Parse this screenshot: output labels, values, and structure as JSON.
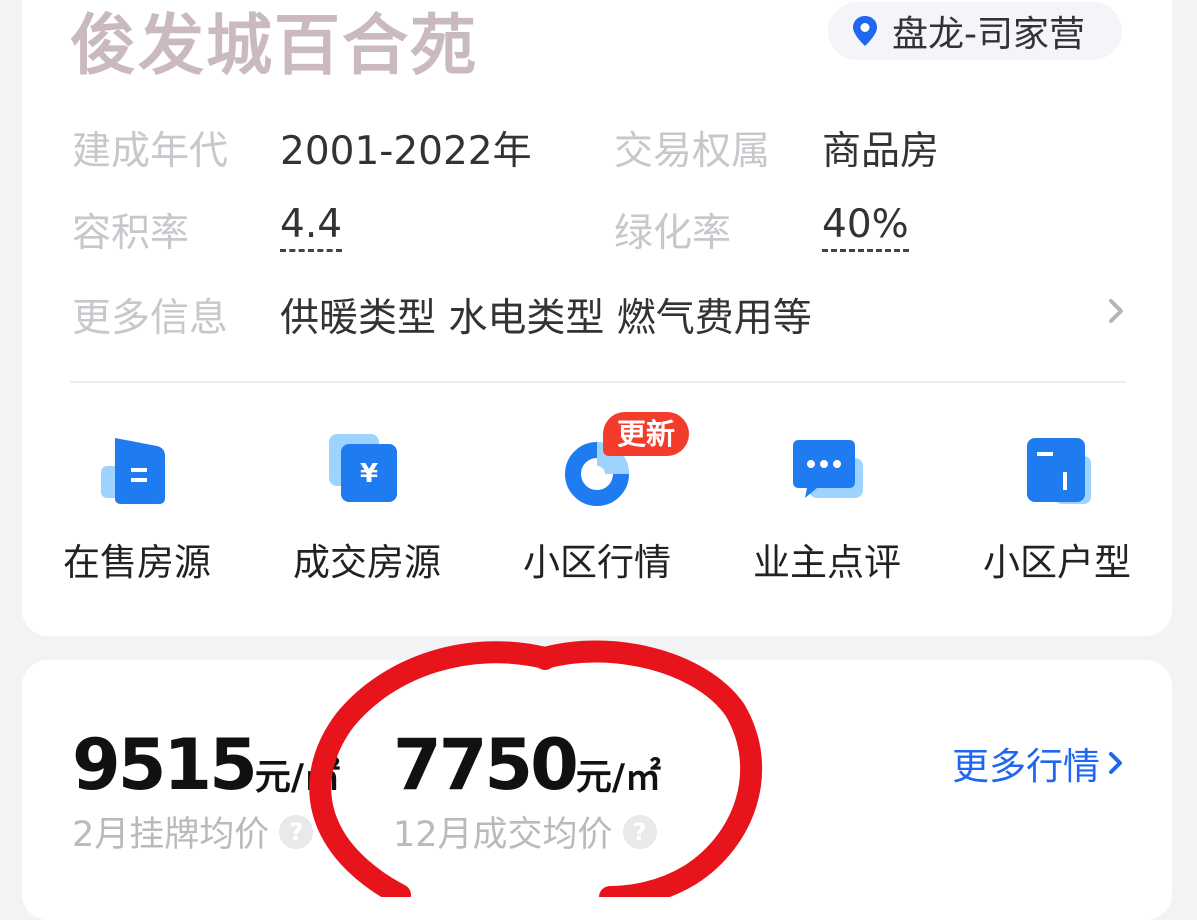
{
  "header": {
    "title": "俊发城百合苑",
    "location": "盘龙-司家营"
  },
  "info": {
    "build_year_label": "建成年代",
    "build_year_value": "2001-2022年",
    "ownership_label": "交易权属",
    "ownership_value": "商品房",
    "plot_ratio_label": "容积率",
    "plot_ratio_value": "4.4",
    "green_ratio_label": "绿化率",
    "green_ratio_value": "40%",
    "more_label": "更多信息",
    "more_value": "供暖类型 水电类型 燃气费用等"
  },
  "quick_links": [
    {
      "label": "在售房源",
      "icon": "listing-doc-icon"
    },
    {
      "label": "成交房源",
      "icon": "yuan-doc-icon"
    },
    {
      "label": "小区行情",
      "icon": "donut-chart-icon",
      "badge": "更新"
    },
    {
      "label": "业主点评",
      "icon": "chat-bubble-icon"
    },
    {
      "label": "小区户型",
      "icon": "floorplan-icon"
    }
  ],
  "prices": {
    "listing_value": "9515",
    "listing_unit": "元/㎡",
    "listing_caption": "2月挂牌均价",
    "deal_value": "7750",
    "deal_unit": "元/㎡",
    "deal_caption": "12月成交均价",
    "more_label": "更多行情"
  },
  "colors": {
    "accent_blue": "#1f66f0",
    "badge_red": "#f23c2c",
    "annotation_red": "#e8141b"
  }
}
